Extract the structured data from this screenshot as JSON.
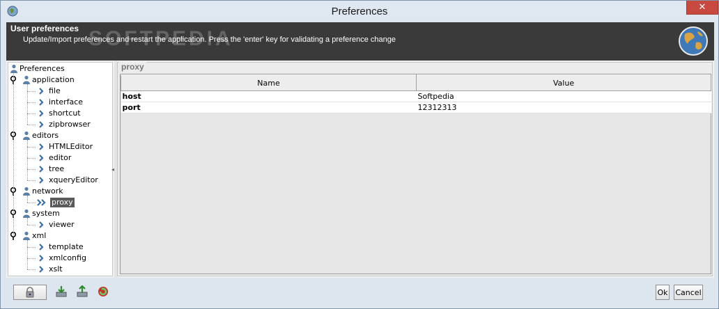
{
  "window": {
    "title": "Preferences",
    "close_glyph": "✕"
  },
  "header": {
    "title": "User preferences",
    "description": "Update/Import preferences and restart the application. Press the 'enter' key for validating a preference change",
    "watermark": "SOFTPEDIA"
  },
  "tree": {
    "root": "Preferences",
    "nodes": [
      {
        "label": "application",
        "children": [
          "file",
          "interface",
          "shortcut",
          "zipbrowser"
        ]
      },
      {
        "label": "editors",
        "children": [
          "HTMLEditor",
          "editor",
          "tree",
          "xqueryEditor"
        ]
      },
      {
        "label": "network",
        "children": [
          "proxy"
        ]
      },
      {
        "label": "system",
        "children": [
          "viewer"
        ]
      },
      {
        "label": "xml",
        "children": [
          "template",
          "xmlconfig",
          "xslt"
        ]
      }
    ],
    "selected": "proxy"
  },
  "panel": {
    "title": "proxy",
    "columns": [
      "Name",
      "Value"
    ],
    "rows": [
      {
        "name": "host",
        "value": "Softpedia"
      },
      {
        "name": "port",
        "value": "12312313"
      }
    ]
  },
  "footer": {
    "ok_label": "Ok",
    "cancel_label": "Cancel",
    "icons": [
      "lock-icon",
      "import-icon",
      "export-icon",
      "restart-icon"
    ]
  },
  "colors": {
    "header_bg": "#3a3a3a",
    "selection_bg": "#5a5a5a",
    "close_red": "#c7493f"
  }
}
